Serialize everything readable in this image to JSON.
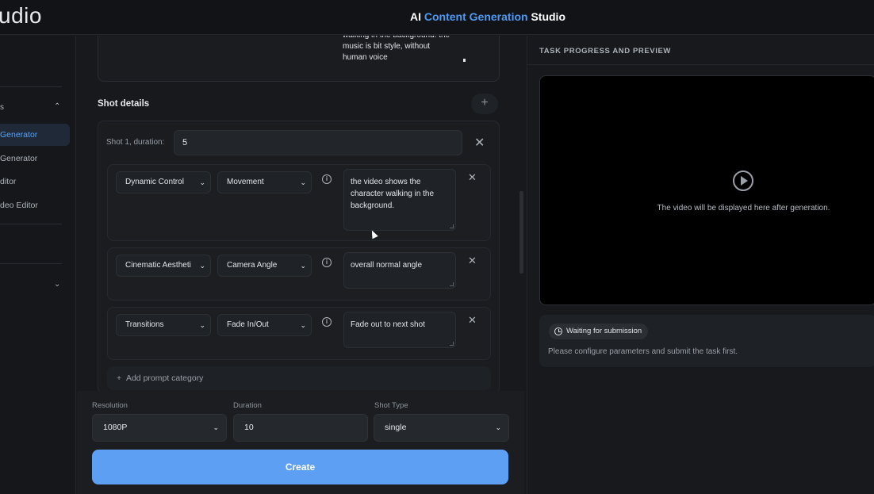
{
  "header": {
    "brand": "udio",
    "title_prefix": "AI ",
    "title_accent": "Content Generation",
    "title_suffix": " Studio"
  },
  "sidebar": {
    "section_label": "s",
    "items": [
      {
        "label": "Generator",
        "active": true
      },
      {
        "label": "Generator",
        "active": false
      },
      {
        "label": "ditor",
        "active": false
      },
      {
        "label": "deo Editor",
        "active": false
      }
    ]
  },
  "description": {
    "text": "walking in the background. the music is bit style, without human voice"
  },
  "shot_details": {
    "title": "Shot details",
    "add_icon": "plus-icon",
    "shot": {
      "label": "Shot 1, duration:",
      "duration_value": "5",
      "prompts": [
        {
          "category": "Dynamic Control",
          "option": "Movement",
          "text": "the video shows the character walking in the background."
        },
        {
          "category": "Cinematic Aestheti",
          "option": "Camera Angle",
          "text": "overall normal angle"
        },
        {
          "category": "Transitions",
          "option": "Fade In/Out",
          "text": "Fade out to next shot"
        }
      ],
      "add_category_label": "Add prompt category"
    }
  },
  "form": {
    "resolution": {
      "label": "Resolution",
      "value": "1080P"
    },
    "duration": {
      "label": "Duration",
      "value": "10"
    },
    "shot_type": {
      "label": "Shot Type",
      "value": "single"
    },
    "create_label": "Create",
    "accent_color": "#5d9ff2"
  },
  "preview": {
    "title": "TASK PROGRESS AND PREVIEW",
    "placeholder": "The video will be displayed here after generation.",
    "status_badge": "Waiting for submission",
    "status_hint": "Please configure parameters and submit the task first."
  }
}
